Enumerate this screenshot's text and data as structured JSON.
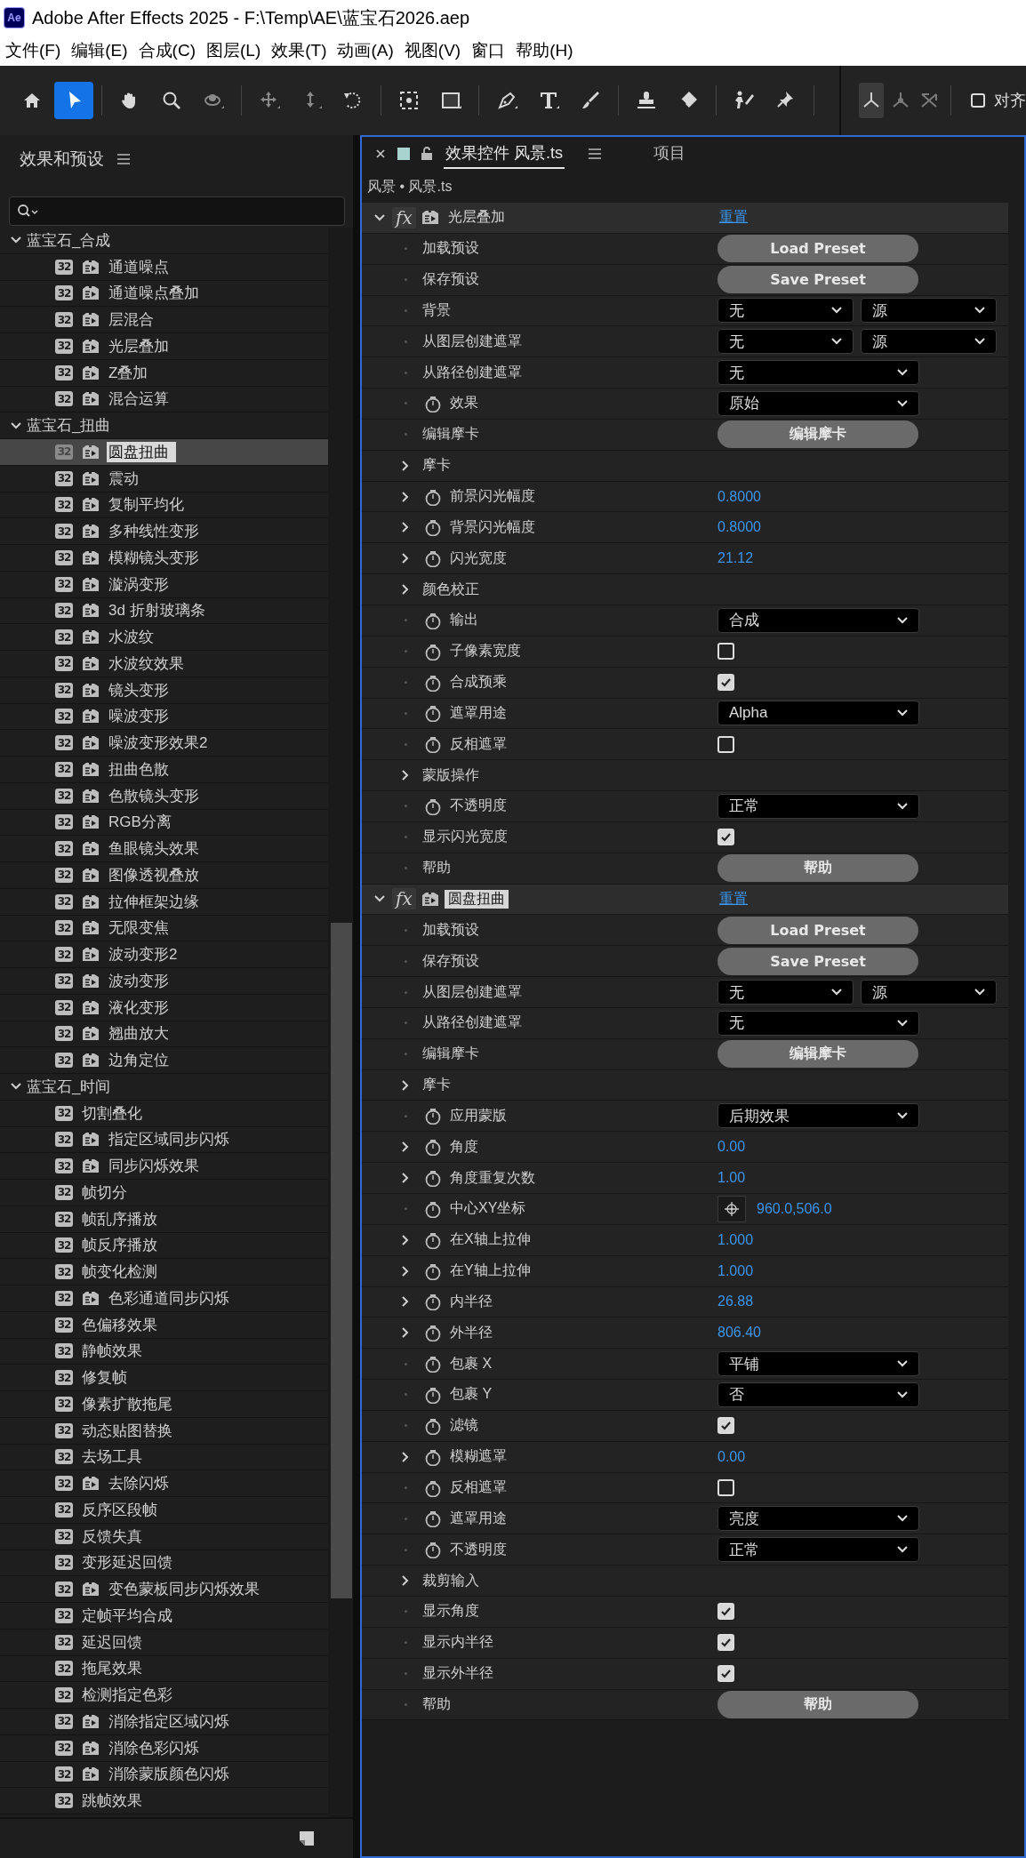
{
  "window": {
    "app_logo": "Ae",
    "title": "Adobe After Effects 2025 - F:\\Temp\\AE\\蓝宝石2026.aep"
  },
  "menu": [
    "文件(F)",
    "编辑(E)",
    "合成(C)",
    "图层(L)",
    "效果(T)",
    "动画(A)",
    "视图(V)",
    "窗口",
    "帮助(H)"
  ],
  "toolbar": {
    "tools": [
      {
        "kind": "home",
        "selected": false
      },
      {
        "kind": "select",
        "selected": true
      },
      {
        "kind": "hand",
        "selected": false
      },
      {
        "kind": "zoom",
        "selected": false
      },
      {
        "kind": "orbit",
        "selected": false
      },
      {
        "kind": "pan",
        "selected": false
      },
      {
        "kind": "dolly",
        "selected": false
      },
      {
        "kind": "rotate",
        "selected": false
      },
      {
        "kind": "anchor",
        "selected": false
      },
      {
        "kind": "rect",
        "selected": false
      },
      {
        "kind": "pen",
        "selected": false
      },
      {
        "kind": "type",
        "selected": false
      },
      {
        "kind": "brush",
        "selected": false
      },
      {
        "kind": "stamp",
        "selected": false
      },
      {
        "kind": "eraser",
        "selected": false
      },
      {
        "kind": "puppet",
        "selected": false
      },
      {
        "kind": "pin",
        "selected": false
      }
    ],
    "axis_modes": [
      {
        "kind": "local",
        "selected": true
      },
      {
        "kind": "world",
        "selected": false
      },
      {
        "kind": "view",
        "selected": false
      }
    ],
    "snap": {
      "label": "对齐",
      "checked": false
    }
  },
  "effects_panel": {
    "title": "效果和预设",
    "groups": [
      {
        "name": "蓝宝石_合成",
        "expanded": true,
        "children": [
          {
            "name": "通道噪点",
            "bit_depth": "32",
            "preset": true,
            "selected": false
          },
          {
            "name": "通道噪点叠加",
            "bit_depth": "32",
            "preset": true,
            "selected": false
          },
          {
            "name": "层混合",
            "bit_depth": "32",
            "preset": true,
            "selected": false
          },
          {
            "name": "光层叠加",
            "bit_depth": "32",
            "preset": true,
            "selected": false
          },
          {
            "name": "Z叠加",
            "bit_depth": "32",
            "preset": true,
            "selected": false
          },
          {
            "name": "混合运算",
            "bit_depth": "32",
            "preset": true,
            "selected": false
          }
        ]
      },
      {
        "name": "蓝宝石_扭曲",
        "expanded": true,
        "children": [
          {
            "name": "圆盘扭曲",
            "bit_depth": "32",
            "preset": true,
            "selected": true
          },
          {
            "name": "震动",
            "bit_depth": "32",
            "preset": true,
            "selected": false
          },
          {
            "name": "复制平均化",
            "bit_depth": "32",
            "preset": true,
            "selected": false
          },
          {
            "name": "多种线性变形",
            "bit_depth": "32",
            "preset": true,
            "selected": false
          },
          {
            "name": "模糊镜头变形",
            "bit_depth": "32",
            "preset": true,
            "selected": false
          },
          {
            "name": "漩涡变形",
            "bit_depth": "32",
            "preset": true,
            "selected": false
          },
          {
            "name": "3d 折射玻璃条",
            "bit_depth": "32",
            "preset": true,
            "selected": false
          },
          {
            "name": "水波纹",
            "bit_depth": "32",
            "preset": true,
            "selected": false
          },
          {
            "name": "水波纹效果",
            "bit_depth": "32",
            "preset": true,
            "selected": false
          },
          {
            "name": "镜头变形",
            "bit_depth": "32",
            "preset": true,
            "selected": false
          },
          {
            "name": "噪波变形",
            "bit_depth": "32",
            "preset": true,
            "selected": false
          },
          {
            "name": "噪波变形效果2",
            "bit_depth": "32",
            "preset": true,
            "selected": false
          },
          {
            "name": "扭曲色散",
            "bit_depth": "32",
            "preset": true,
            "selected": false
          },
          {
            "name": "色散镜头变形",
            "bit_depth": "32",
            "preset": true,
            "selected": false
          },
          {
            "name": "RGB分离",
            "bit_depth": "32",
            "preset": true,
            "selected": false
          },
          {
            "name": "鱼眼镜头效果",
            "bit_depth": "32",
            "preset": true,
            "selected": false
          },
          {
            "name": "图像透视叠放",
            "bit_depth": "32",
            "preset": true,
            "selected": false
          },
          {
            "name": "拉伸框架边缘",
            "bit_depth": "32",
            "preset": true,
            "selected": false
          },
          {
            "name": "无限变焦",
            "bit_depth": "32",
            "preset": true,
            "selected": false
          },
          {
            "name": "波动变形2",
            "bit_depth": "32",
            "preset": true,
            "selected": false
          },
          {
            "name": "波动变形",
            "bit_depth": "32",
            "preset": true,
            "selected": false
          },
          {
            "name": "液化变形",
            "bit_depth": "32",
            "preset": true,
            "selected": false
          },
          {
            "name": "翘曲放大",
            "bit_depth": "32",
            "preset": true,
            "selected": false
          },
          {
            "name": "边角定位",
            "bit_depth": "32",
            "preset": true,
            "selected": false
          }
        ]
      },
      {
        "name": "蓝宝石_时间",
        "expanded": true,
        "children": [
          {
            "name": "切割叠化",
            "bit_depth": "32",
            "preset": false,
            "selected": false
          },
          {
            "name": "指定区域同步闪烁",
            "bit_depth": "32",
            "preset": true,
            "selected": false
          },
          {
            "name": "同步闪烁效果",
            "bit_depth": "32",
            "preset": true,
            "selected": false
          },
          {
            "name": "帧切分",
            "bit_depth": "32",
            "preset": false,
            "selected": false
          },
          {
            "name": "帧乱序播放",
            "bit_depth": "32",
            "preset": false,
            "selected": false
          },
          {
            "name": "帧反序播放",
            "bit_depth": "32",
            "preset": false,
            "selected": false
          },
          {
            "name": "帧变化检测",
            "bit_depth": "32",
            "preset": false,
            "selected": false
          },
          {
            "name": "色彩通道同步闪烁",
            "bit_depth": "32",
            "preset": true,
            "selected": false
          },
          {
            "name": "色偏移效果",
            "bit_depth": "32",
            "preset": false,
            "selected": false
          },
          {
            "name": "静帧效果",
            "bit_depth": "32",
            "preset": false,
            "selected": false
          },
          {
            "name": "修复帧",
            "bit_depth": "32",
            "preset": false,
            "selected": false
          },
          {
            "name": "像素扩散拖尾",
            "bit_depth": "32",
            "preset": false,
            "selected": false
          },
          {
            "name": "动态贴图替换",
            "bit_depth": "32",
            "preset": false,
            "selected": false
          },
          {
            "name": "去场工具",
            "bit_depth": "32",
            "preset": false,
            "selected": false
          },
          {
            "name": "去除闪烁",
            "bit_depth": "32",
            "preset": true,
            "selected": false
          },
          {
            "name": "反序区段帧",
            "bit_depth": "32",
            "preset": false,
            "selected": false
          },
          {
            "name": "反馈失真",
            "bit_depth": "32",
            "preset": false,
            "selected": false
          },
          {
            "name": "变形延迟回馈",
            "bit_depth": "32",
            "preset": false,
            "selected": false
          },
          {
            "name": "变色蒙板同步闪烁效果",
            "bit_depth": "32",
            "preset": true,
            "selected": false
          },
          {
            "name": "定帧平均合成",
            "bit_depth": "32",
            "preset": false,
            "selected": false
          },
          {
            "name": "延迟回馈",
            "bit_depth": "32",
            "preset": false,
            "selected": false
          },
          {
            "name": "拖尾效果",
            "bit_depth": "32",
            "preset": false,
            "selected": false
          },
          {
            "name": "检测指定色彩",
            "bit_depth": "32",
            "preset": false,
            "selected": false
          },
          {
            "name": "消除指定区域闪烁",
            "bit_depth": "32",
            "preset": true,
            "selected": false
          },
          {
            "name": "消除色彩闪烁",
            "bit_depth": "32",
            "preset": true,
            "selected": false
          },
          {
            "name": "消除蒙版颜色闪烁",
            "bit_depth": "32",
            "preset": true,
            "selected": false
          },
          {
            "name": "跳帧效果",
            "bit_depth": "32",
            "preset": false,
            "selected": false
          }
        ]
      }
    ]
  },
  "effect_controls": {
    "tabs": [
      {
        "label": "效果控件 风景.ts",
        "selected": true
      },
      {
        "label": "项目",
        "selected": false
      }
    ],
    "breadcrumb": "风景 • 风景.ts",
    "effects": [
      {
        "fx": "fx",
        "name": "光层叠加",
        "selected": false,
        "expanded": true,
        "reset": "重置",
        "rows": [
          {
            "kind": "button",
            "label": "加载预设",
            "stopwatch": false,
            "button": "Load Preset"
          },
          {
            "kind": "button",
            "label": "保存预设",
            "stopwatch": false,
            "button": "Save Preset"
          },
          {
            "kind": "dropdown",
            "label": "背景",
            "stopwatch": false,
            "values": [
              "无",
              "源"
            ]
          },
          {
            "kind": "dropdown",
            "label": "从图层创建遮罩",
            "stopwatch": false,
            "values": [
              "无",
              "源"
            ]
          },
          {
            "kind": "dropdown",
            "label": "从路径创建遮罩",
            "stopwatch": false,
            "values": [
              "无"
            ]
          },
          {
            "kind": "dropdown",
            "label": "效果",
            "stopwatch": true,
            "values": [
              "原始"
            ]
          },
          {
            "kind": "button",
            "label": "编辑摩卡",
            "stopwatch": false,
            "button": "编辑摩卡"
          },
          {
            "kind": "group",
            "label": "摩卡",
            "stopwatch": false,
            "expanded": false
          },
          {
            "kind": "number",
            "label": "前景闪光幅度",
            "stopwatch": true,
            "expanded": false,
            "value": "0.8000"
          },
          {
            "kind": "number",
            "label": "背景闪光幅度",
            "stopwatch": true,
            "expanded": false,
            "value": "0.8000"
          },
          {
            "kind": "number",
            "label": "闪光宽度",
            "stopwatch": true,
            "expanded": false,
            "value": "21.12"
          },
          {
            "kind": "group",
            "label": "颜色校正",
            "stopwatch": false,
            "expanded": false
          },
          {
            "kind": "dropdown",
            "label": "输出",
            "stopwatch": true,
            "values": [
              "合成"
            ]
          },
          {
            "kind": "checkbox",
            "label": "子像素宽度",
            "stopwatch": true,
            "checked": false
          },
          {
            "kind": "checkbox",
            "label": "合成预乘",
            "stopwatch": true,
            "checked": true
          },
          {
            "kind": "dropdown",
            "label": "遮罩用途",
            "stopwatch": true,
            "values": [
              "Alpha"
            ]
          },
          {
            "kind": "checkbox",
            "label": "反相遮罩",
            "stopwatch": true,
            "checked": false
          },
          {
            "kind": "group",
            "label": "蒙版操作",
            "stopwatch": false,
            "expanded": false
          },
          {
            "kind": "dropdown",
            "label": "不透明度",
            "stopwatch": true,
            "values": [
              "正常"
            ]
          },
          {
            "kind": "checkbox",
            "label": "显示闪光宽度",
            "stopwatch": false,
            "checked": true
          },
          {
            "kind": "button",
            "label": "帮助",
            "stopwatch": false,
            "button": "帮助"
          }
        ]
      },
      {
        "fx": "fx",
        "name": "圆盘扭曲",
        "selected": true,
        "expanded": true,
        "reset": "重置",
        "rows": [
          {
            "kind": "button",
            "label": "加载预设",
            "stopwatch": false,
            "button": "Load Preset"
          },
          {
            "kind": "button",
            "label": "保存预设",
            "stopwatch": false,
            "button": "Save Preset"
          },
          {
            "kind": "dropdown",
            "label": "从图层创建遮罩",
            "stopwatch": false,
            "values": [
              "无",
              "源"
            ]
          },
          {
            "kind": "dropdown",
            "label": "从路径创建遮罩",
            "stopwatch": false,
            "values": [
              "无"
            ]
          },
          {
            "kind": "button",
            "label": "编辑摩卡",
            "stopwatch": false,
            "button": "编辑摩卡"
          },
          {
            "kind": "group",
            "label": "摩卡",
            "stopwatch": false,
            "expanded": false
          },
          {
            "kind": "dropdown",
            "label": "应用蒙版",
            "stopwatch": true,
            "values": [
              "后期效果"
            ]
          },
          {
            "kind": "number",
            "label": "角度",
            "stopwatch": true,
            "expanded": false,
            "value": "0.00"
          },
          {
            "kind": "number",
            "label": "角度重复次数",
            "stopwatch": true,
            "expanded": false,
            "value": "1.00"
          },
          {
            "kind": "point",
            "label": "中心XY坐标",
            "stopwatch": true,
            "value": "960.0,506.0"
          },
          {
            "kind": "number",
            "label": "在X轴上拉伸",
            "stopwatch": true,
            "expanded": false,
            "value": "1.000"
          },
          {
            "kind": "number",
            "label": "在Y轴上拉伸",
            "stopwatch": true,
            "expanded": false,
            "value": "1.000"
          },
          {
            "kind": "number",
            "label": "内半径",
            "stopwatch": true,
            "expanded": false,
            "value": "26.88"
          },
          {
            "kind": "number",
            "label": "外半径",
            "stopwatch": true,
            "expanded": false,
            "value": "806.40"
          },
          {
            "kind": "dropdown",
            "label": "包裹 X",
            "stopwatch": true,
            "values": [
              "平铺"
            ]
          },
          {
            "kind": "dropdown",
            "label": "包裹 Y",
            "stopwatch": true,
            "values": [
              "否"
            ]
          },
          {
            "kind": "checkbox",
            "label": "滤镜",
            "stopwatch": true,
            "checked": true
          },
          {
            "kind": "number",
            "label": "模糊遮罩",
            "stopwatch": true,
            "expanded": false,
            "value": "0.00"
          },
          {
            "kind": "checkbox",
            "label": "反相遮罩",
            "stopwatch": true,
            "checked": false
          },
          {
            "kind": "dropdown",
            "label": "遮罩用途",
            "stopwatch": true,
            "values": [
              "亮度"
            ]
          },
          {
            "kind": "dropdown",
            "label": "不透明度",
            "stopwatch": true,
            "values": [
              "正常"
            ]
          },
          {
            "kind": "group",
            "label": "裁剪输入",
            "stopwatch": false,
            "expanded": false
          },
          {
            "kind": "checkbox",
            "label": "显示角度",
            "stopwatch": false,
            "checked": true
          },
          {
            "kind": "checkbox",
            "label": "显示内半径",
            "stopwatch": false,
            "checked": true
          },
          {
            "kind": "checkbox",
            "label": "显示外半径",
            "stopwatch": false,
            "checked": true
          },
          {
            "kind": "button",
            "label": "帮助",
            "stopwatch": false,
            "button": "帮助"
          }
        ]
      }
    ]
  }
}
